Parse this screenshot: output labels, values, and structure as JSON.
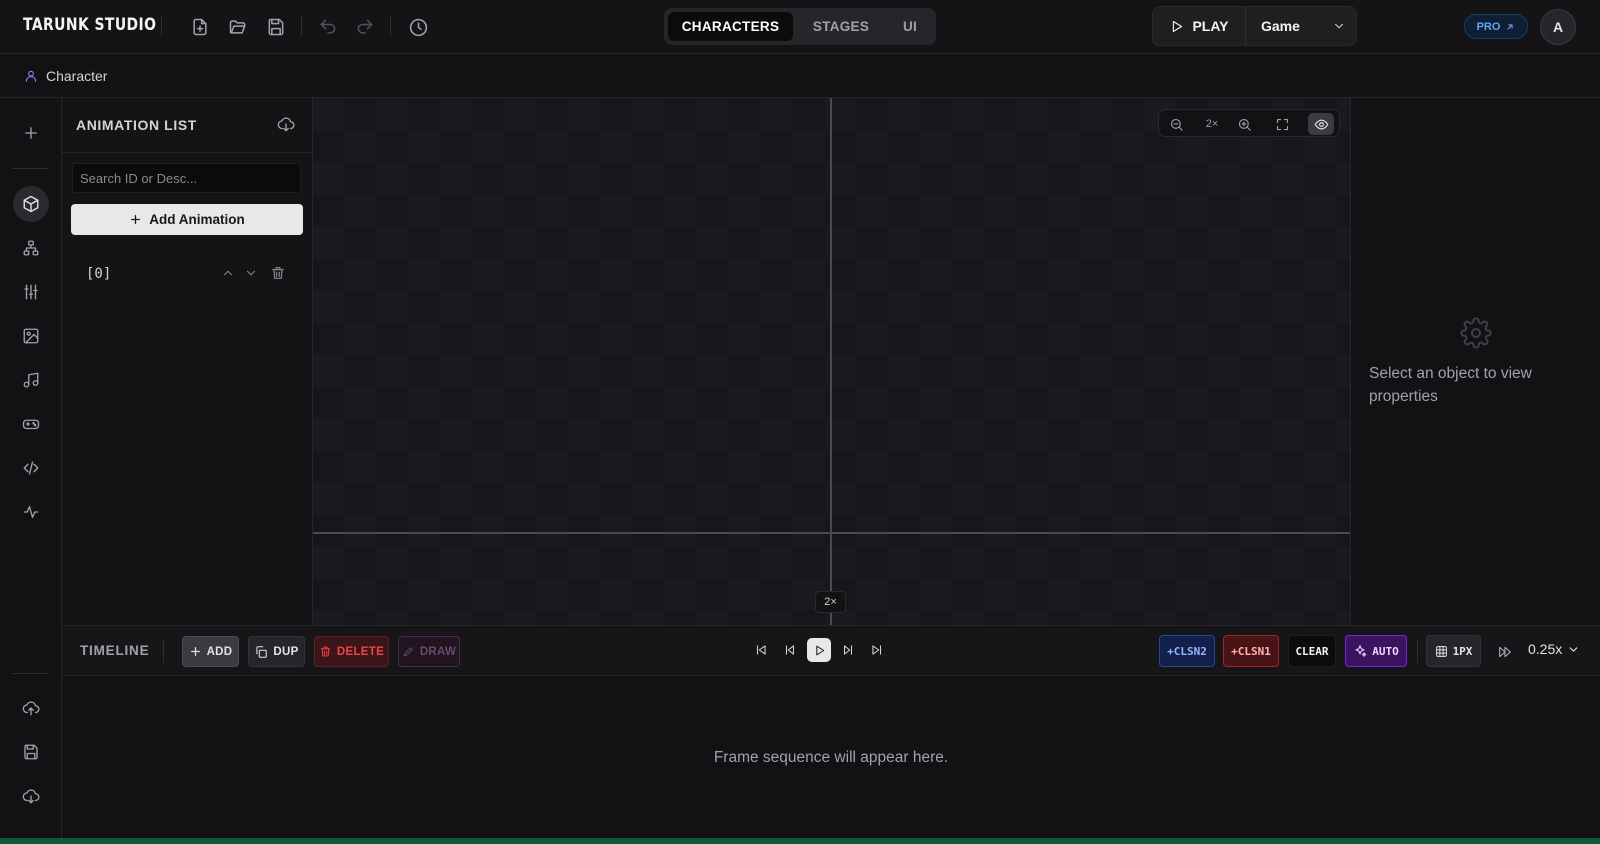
{
  "app": {
    "brand": "TARUNK STUDIO",
    "mode_tabs": [
      {
        "label": "CHARACTERS",
        "active": true
      },
      {
        "label": "STAGES",
        "active": false
      },
      {
        "label": "UI",
        "active": false
      }
    ],
    "play_label": "PLAY",
    "target_select": "Game",
    "pro_label": "PRO",
    "avatar_initial": "A"
  },
  "breadcrumb": {
    "label": "Character"
  },
  "animation_list": {
    "title": "ANIMATION LIST",
    "search_placeholder": "Search ID or Desc...",
    "add_label": "Add Animation",
    "items": [
      {
        "label": "[0]"
      }
    ]
  },
  "canvas": {
    "zoom_label": "2×",
    "zoom_tag": "2×"
  },
  "properties": {
    "empty_hint": "Select an object to view properties"
  },
  "timeline": {
    "title": "TIMELINE",
    "add_label": "ADD",
    "dup_label": "DUP",
    "delete_label": "DELETE",
    "draw_label": "DRAW",
    "tags": {
      "clsn2": "+CLSN2",
      "clsn1": "+CLSN1",
      "clear": "CLEAR",
      "auto": "AUTO",
      "px": "1PX"
    },
    "speed": "0.25x",
    "empty_hint": "Frame sequence will appear here."
  },
  "colors": {
    "accent_indigo": "#818cf8",
    "pro_blue": "#60a5fa",
    "clsn2_blue": "#1e3a8a",
    "clsn1_red": "#7f1d1d",
    "auto_purple": "#581c87",
    "delete_red": "#ef4444",
    "status_green": "#0f5a3f"
  }
}
